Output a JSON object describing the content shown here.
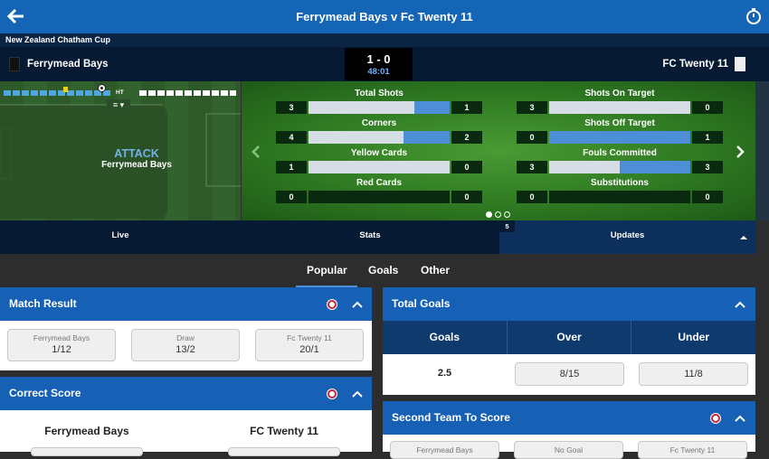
{
  "header": {
    "title": "Ferrymead Bays v Fc Twenty 11"
  },
  "competition": "New Zealand Chatham Cup",
  "match": {
    "home": "Ferrymead Bays",
    "away": "FC Twenty 11",
    "score": "1 - 0",
    "time": "48:01"
  },
  "pitch": {
    "status": "ATTACK",
    "team": "Ferrymead Bays",
    "ht_label": "HT"
  },
  "stats": [
    {
      "label": "Total Shots",
      "home": "3",
      "away": "1",
      "away_share": 0.25
    },
    {
      "label": "Shots On Target",
      "home": "3",
      "away": "0",
      "away_share": 0
    },
    {
      "label": "Corners",
      "home": "4",
      "away": "2",
      "away_share": 0.33
    },
    {
      "label": "Shots Off Target",
      "home": "0",
      "away": "1",
      "away_share": 1
    },
    {
      "label": "Yellow Cards",
      "home": "1",
      "away": "0",
      "away_share": 0
    },
    {
      "label": "Fouls Committed",
      "home": "3",
      "away": "3",
      "away_share": 0.5
    },
    {
      "label": "Red Cards",
      "home": "0",
      "away": "0",
      "away_share": null
    },
    {
      "label": "Substitutions",
      "home": "0",
      "away": "0",
      "away_share": null
    }
  ],
  "tabs": [
    "Live",
    "Stats",
    "Updates"
  ],
  "updates_badge": "5",
  "market_tabs": [
    "Popular",
    "Goals",
    "Other"
  ],
  "match_result": {
    "title": "Match Result",
    "options": [
      {
        "name": "Ferrymead Bays",
        "odds": "1/12"
      },
      {
        "name": "Draw",
        "odds": "13/2"
      },
      {
        "name": "Fc Twenty 11",
        "odds": "20/1"
      }
    ]
  },
  "correct_score": {
    "title": "Correct Score",
    "home": "Ferrymead Bays",
    "away": "FC Twenty 11"
  },
  "total_goals": {
    "title": "Total Goals",
    "headers": [
      "Goals",
      "Over",
      "Under"
    ],
    "line": "2.5",
    "over": "8/15",
    "under": "11/8"
  },
  "second_team": {
    "title": "Second Team To Score",
    "options": [
      "Ferrymead Bays",
      "No Goal",
      "Fc Twenty 11"
    ]
  },
  "colors": {
    "header": "#1565b7",
    "accent": "#4d8ed6",
    "dark": "#061a33"
  }
}
